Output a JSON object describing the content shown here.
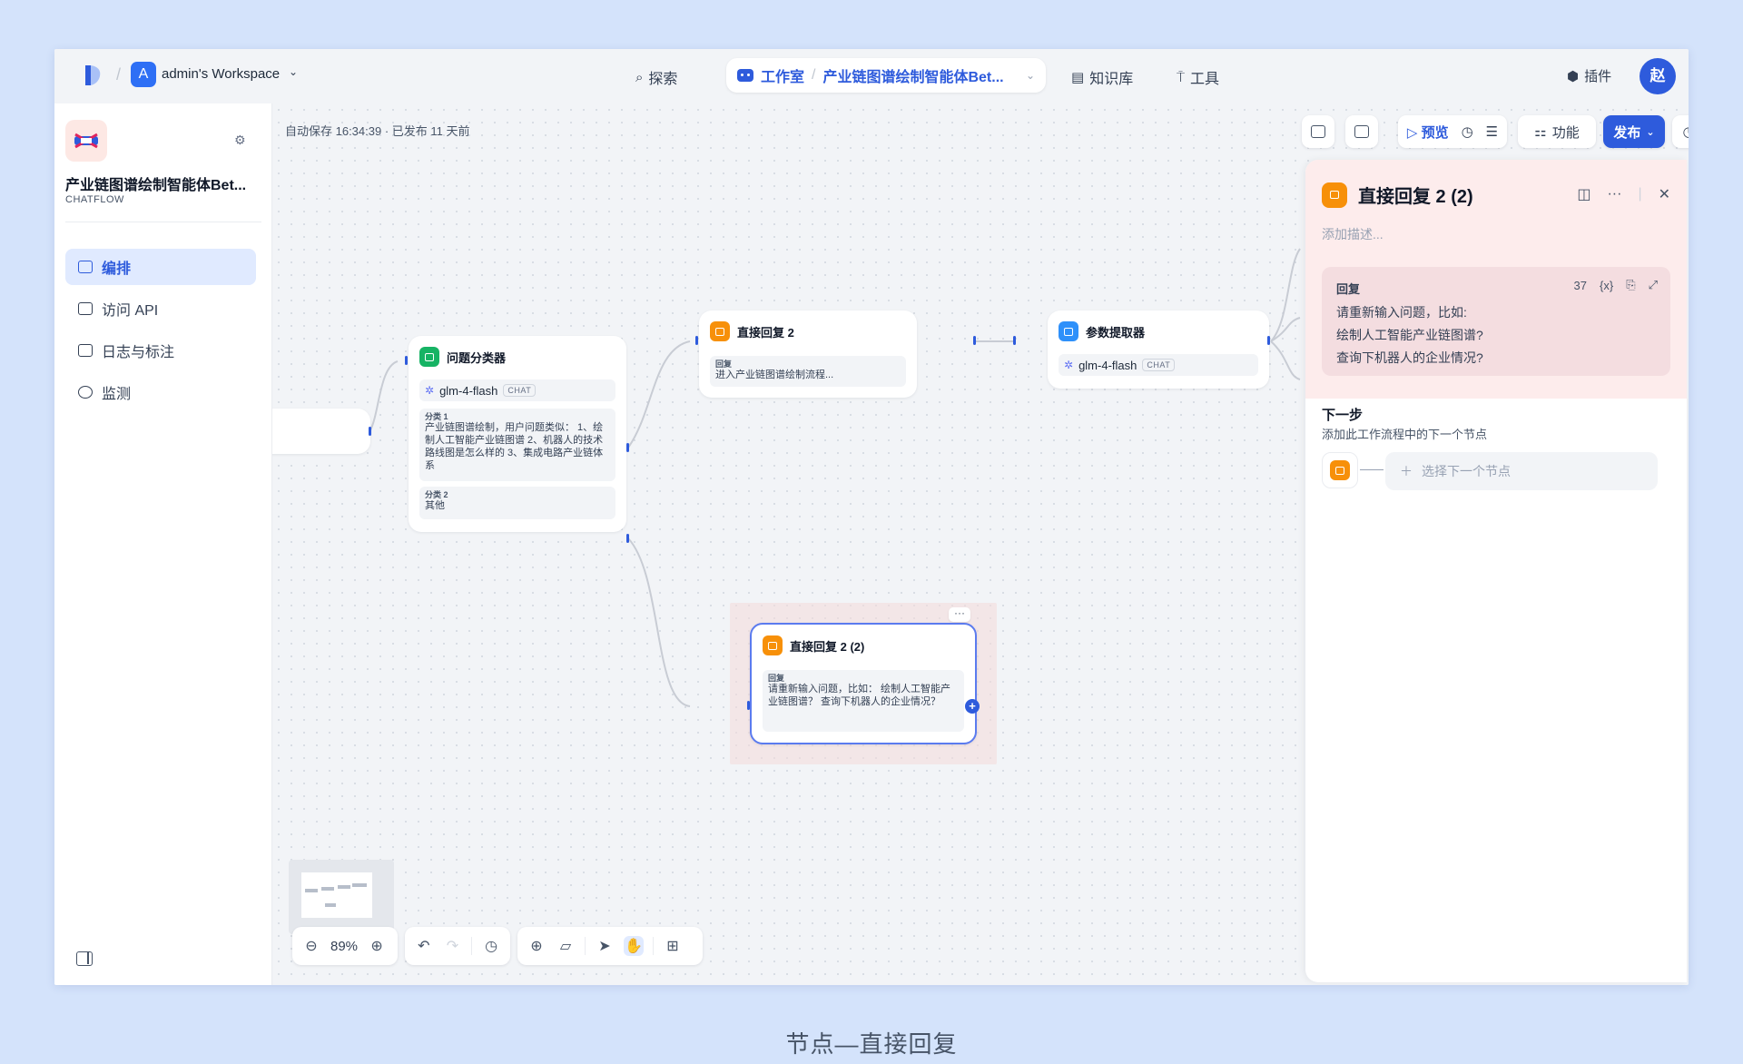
{
  "workspace": {
    "avatar_letter": "A",
    "name": "admin's Workspace"
  },
  "nav": {
    "explore": "探索",
    "studio": "工作室",
    "app_name": "产业链图谱绘制智能体Bet...",
    "knowledge": "知识库",
    "tools": "工具",
    "plugins": "插件",
    "user_initial": "赵"
  },
  "sidebar": {
    "app_title": "产业链图谱绘制智能体Bet...",
    "app_type": "CHATFLOW",
    "items": [
      {
        "label": "编排",
        "active": true
      },
      {
        "label": "访问 API",
        "active": false
      },
      {
        "label": "日志与标注",
        "active": false
      },
      {
        "label": "监测",
        "active": false
      }
    ]
  },
  "canvas": {
    "autosave": "自动保存 16:34:39 · 已发布 11 天前",
    "toolbar": {
      "preview": "预览",
      "features": "功能",
      "publish": "发布"
    },
    "zoom": "89%"
  },
  "nodes": {
    "classifier": {
      "title": "问题分类器",
      "model": "glm-4-flash",
      "model_chip": "CHAT",
      "class1_label": "分类 1",
      "class1_text": "产业链图谱绘制，用户问题类似： 1、绘制人工智能产业链图谱 2、机器人的技术路线图是怎么样的 3、集成电路产业链体系",
      "class2_label": "分类 2",
      "class2_text": "其他"
    },
    "reply2": {
      "title": "直接回复 2",
      "label": "回复",
      "text": "进入产业链图谱绘制流程..."
    },
    "extractor": {
      "title": "参数提取器",
      "model": "glm-4-flash",
      "model_chip": "CHAT"
    },
    "reply22": {
      "title": "直接回复 2 (2)",
      "label": "回复",
      "text": "请重新输入问题，比如： 绘制人工智能产业链图谱？ 查询下机器人的企业情况？",
      "more": "···",
      "plus": "+"
    }
  },
  "panel": {
    "title": "直接回复 2 (2)",
    "description_placeholder": "添加描述...",
    "reply_label": "回复",
    "char_count": "37",
    "var_button": "{x}",
    "reply_lines": [
      "请重新输入问题，比如:",
      "绘制人工智能产业链图谱?",
      "查询下机器人的企业情况?"
    ],
    "next_title": "下一步",
    "next_sub": "添加此工作流程中的下一个节点",
    "next_select": "选择下一个节点"
  },
  "caption": "节点—直接回复",
  "colors": {
    "accent": "#2e5bdc",
    "reply_node": "#f79009",
    "classifier_node": "#16b364",
    "extractor_node": "#2e90fa",
    "background": "#d4e3fb"
  }
}
